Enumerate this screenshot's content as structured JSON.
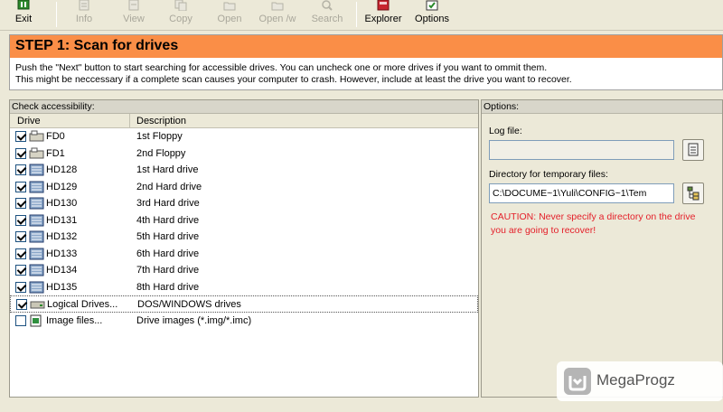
{
  "toolbar": {
    "exit": "Exit",
    "info": "Info",
    "view": "View",
    "copy": "Copy",
    "open": "Open",
    "open_with": "Open /w",
    "search": "Search",
    "explorer": "Explorer",
    "options": "Options"
  },
  "step": {
    "title": "STEP 1: Scan for drives",
    "line1": "Push the \"Next\" button to start searching for accessible drives. You can uncheck one or more drives if you want to ommit them.",
    "line2": "This might be neccessary if a complete scan causes your computer to crash. However, include at least the drive you want to recover."
  },
  "left_panel": {
    "caption": "Check accessibility:",
    "col_drive": "Drive",
    "col_description": "Description",
    "rows": [
      {
        "drive": "FD0",
        "desc": "1st Floppy"
      },
      {
        "drive": "FD1",
        "desc": "2nd Floppy"
      },
      {
        "drive": "HD128",
        "desc": "1st Hard drive"
      },
      {
        "drive": "HD129",
        "desc": "2nd Hard drive"
      },
      {
        "drive": "HD130",
        "desc": "3rd Hard drive"
      },
      {
        "drive": "HD131",
        "desc": "4th Hard drive"
      },
      {
        "drive": "HD132",
        "desc": "5th Hard drive"
      },
      {
        "drive": "HD133",
        "desc": "6th Hard drive"
      },
      {
        "drive": "HD134",
        "desc": "7th Hard drive"
      },
      {
        "drive": "HD135",
        "desc": "8th Hard drive"
      },
      {
        "drive": "Logical Drives...",
        "desc": "DOS/WINDOWS drives"
      },
      {
        "drive": "Image files...",
        "desc": "Drive images (*.img/*.imc)"
      }
    ]
  },
  "right_panel": {
    "caption": "Options:",
    "log_label": "Log file:",
    "log_value": "",
    "tempdir_label": "Directory for temporary files:",
    "tempdir_value": "C:\\DOCUME~1\\Yuli\\CONFIG~1\\Tem",
    "caution": "CAUTION: Never specify a directory on the drive you are going to recover!"
  },
  "watermark": {
    "text": "MegaProgz"
  },
  "colors": {
    "step_header": "#fa8e47",
    "caution": "#e4202a",
    "window_bg": "#ece9d8"
  }
}
